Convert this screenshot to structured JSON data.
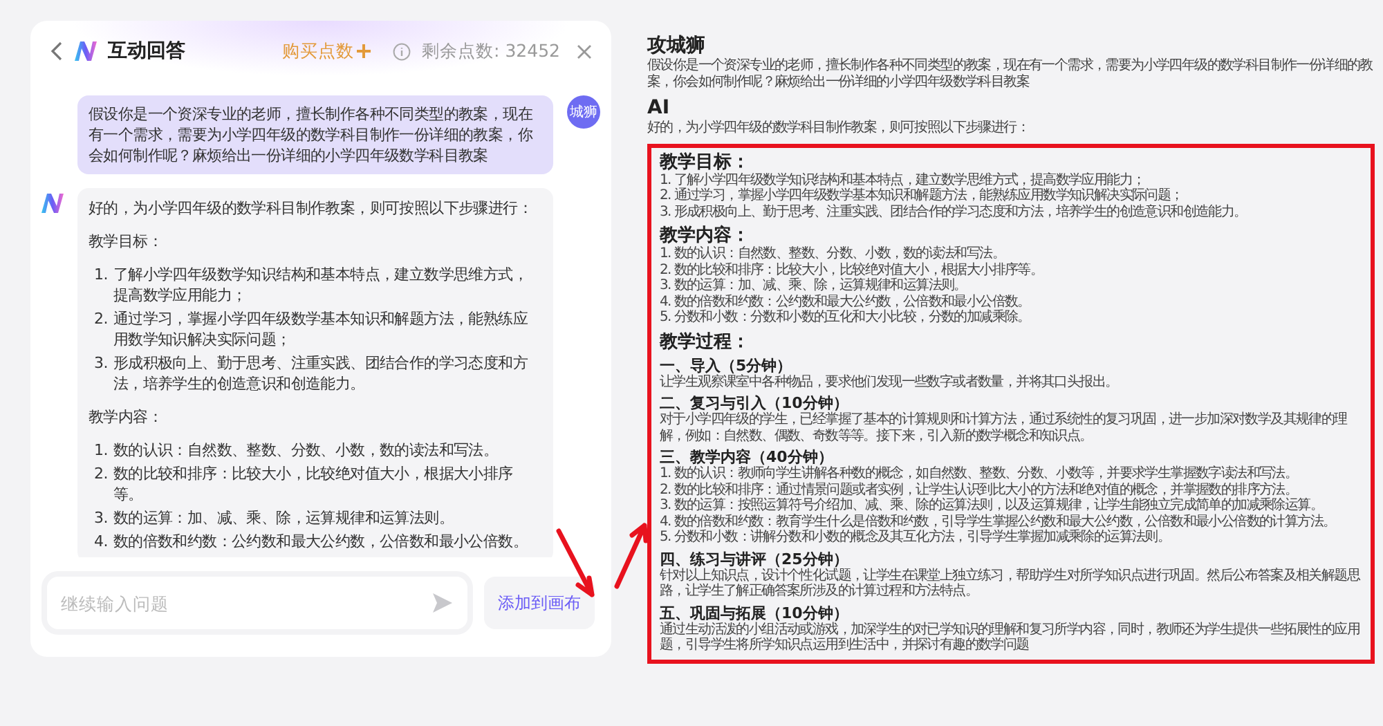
{
  "header": {
    "title": "互动回答",
    "buy_label": "购买点数",
    "points_label": "剩余点数: 32452"
  },
  "chat": {
    "user": {
      "avatar": "城狮",
      "text": "假设你是一个资深专业的老师，擅长制作各种不同类型的教案，现在有一个需求，需要为小学四年级的数学科目制作一份详细的教案，你会如何制作呢？麻烦给出一份详细的小学四年级数学科目教案"
    },
    "ai": {
      "intro": "好的，为小学四年级的数学科目制作教案，则可按照以下步骤进行：",
      "sections": [
        {
          "heading": "教学目标：",
          "items": [
            {
              "number": "1.",
              "text": "了解小学四年级数学知识结构和基本特点，建立数学思维方式，提高数学应用能力；"
            },
            {
              "number": "2.",
              "text": "通过学习，掌握小学四年级数学基本知识和解题方法，能熟练应用数学知识解决实际问题；"
            },
            {
              "number": "3.",
              "text": "形成积极向上、勤于思考、注重实践、团结合作的学习态度和方法，培养学生的创造意识和创造能力。"
            }
          ]
        },
        {
          "heading": "教学内容：",
          "items": [
            {
              "number": "1.",
              "text": "数的认识：自然数、整数、分数、小数，数的读法和写法。"
            },
            {
              "number": "2.",
              "text": "数的比较和排序：比较大小，比较绝对值大小，根据大小排序等。"
            },
            {
              "number": "3.",
              "text": "数的运算：加、减、乘、除，运算规律和运算法则。"
            },
            {
              "number": "4.",
              "text": "数的倍数和约数：公约数和最大公约数，公倍数和最小公倍数。"
            }
          ]
        }
      ]
    }
  },
  "input": {
    "placeholder": "继续输入问题"
  },
  "add_button": "添加到画布",
  "document": {
    "user": {
      "name": "攻城狮",
      "text": "假设你是一个资深专业的老师，擅长制作各种不同类型的教案，现在有一个需求，需要为小学四年级的数学科目制作一份详细的教案，你会如何制作呢？麻烦给出一份详细的小学四年级数学科目教案"
    },
    "ai": {
      "name": "AI",
      "text": "好的，为小学四年级的数学科目制作教案，则可按照以下步骤进行："
    },
    "sections": [
      {
        "kind": "list",
        "heading": "教学目标：",
        "lines": [
          "1. 了解小学四年级数学知识结构和基本特点，建立数学思维方式，提高数学应用能力；",
          "2. 通过学习，掌握小学四年级数学基本知识和解题方法，能熟练应用数学知识解决实际问题；",
          "3. 形成积极向上、勤于思考、注重实践、团结合作的学习态度和方法，培养学生的创造意识和创造能力。"
        ]
      },
      {
        "kind": "list",
        "heading": "教学内容：",
        "lines": [
          "1. 数的认识：自然数、整数、分数、小数，数的读法和写法。",
          "2. 数的比较和排序：比较大小，比较绝对值大小，根据大小排序等。",
          "3. 数的运算：加、减、乘、除，运算规律和运算法则。",
          "4. 数的倍数和约数：公约数和最大公约数，公倍数和最小公倍数。",
          "5. 分数和小数：分数和小数的互化和大小比较，分数的加减乘除。"
        ]
      },
      {
        "kind": "steps",
        "heading": "教学过程：",
        "steps": [
          {
            "title": "一、导入（5分钟）",
            "lines": [
              "让学生观察课室中各种物品，要求他们发现一些数字或者数量，并将其口头报出。"
            ]
          },
          {
            "title": "二、复习与引入（10分钟）",
            "lines": [
              "对于小学四年级的学生，已经掌握了基本的计算规则和计算方法，通过系统性的复习巩固，进一步加深对数学及其规律的理解，例如：自然数、偶数、奇数等等。接下来，引入新的数学概念和知识点。"
            ]
          },
          {
            "title": "三、教学内容（40分钟）",
            "lines": [
              "1. 数的认识：教师向学生讲解各种数的概念，如自然数、整数、分数、小数等，并要求学生掌握数字读法和写法。",
              "2. 数的比较和排序：通过情景问题或者实例，让学生认识到比大小的方法和绝对值的概念，并掌握数的排序方法。",
              "3. 数的运算：按照运算符号介绍加、减、乘、除的运算法则，以及运算规律，让学生能独立完成简单的加减乘除运算。",
              "4. 数的倍数和约数：教育学生什么是倍数和约数，引导学生掌握公约数和最大公约数，公倍数和最小公倍数的计算方法。",
              "5. 分数和小数：讲解分数和小数的概念及其互化方法，引导学生掌握加减乘除的运算法则。"
            ]
          },
          {
            "title": "四、练习与讲评（25分钟）",
            "lines": [
              "针对以上知识点，设计个性化试题，让学生在课堂上独立练习，帮助学生对所学知识点进行巩固。然后公布答案及相关解题思路，让学生了解正确答案所涉及的计算过程和方法特点。"
            ]
          },
          {
            "title": "五、巩固与拓展（10分钟）",
            "lines": [
              "通过生动活泼的小组活动或游戏，加深学生的对已学知识的理解和复习所学内容，同时，教师还为学生提供一些拓展性的应用题，引导学生将所学知识点运用到生活中，并探讨有趣的数学问题"
            ]
          }
        ]
      }
    ]
  }
}
